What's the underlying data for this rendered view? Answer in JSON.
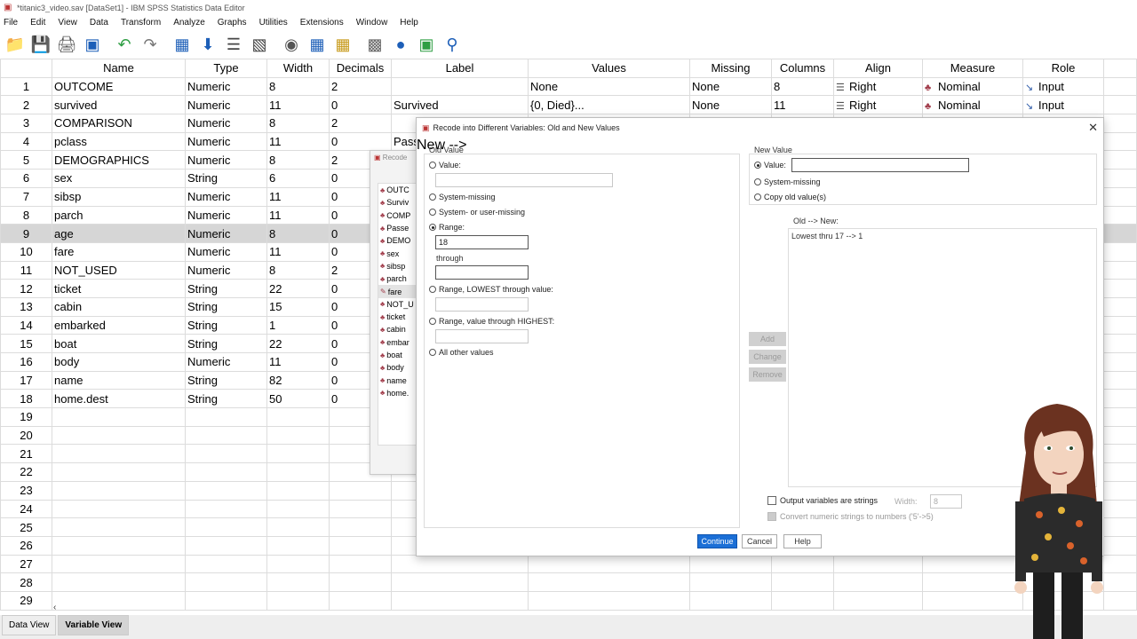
{
  "window": {
    "title": "*titanic3_video.sav [DataSet1] - IBM SPSS Statistics Data Editor"
  },
  "menu": [
    "File",
    "Edit",
    "View",
    "Data",
    "Transform",
    "Analyze",
    "Graphs",
    "Utilities",
    "Extensions",
    "Window",
    "Help"
  ],
  "grid": {
    "columns": [
      "Name",
      "Type",
      "Width",
      "Decimals",
      "Label",
      "Values",
      "Missing",
      "Columns",
      "Align",
      "Measure",
      "Role"
    ],
    "rows": [
      {
        "n": "1",
        "name": "OUTCOME",
        "type": "Numeric",
        "width": "8",
        "dec": "2",
        "label": "",
        "values": "None",
        "missing": "None",
        "cols": "8",
        "align": "Right",
        "measure": "Nominal",
        "role": "Input"
      },
      {
        "n": "2",
        "name": "survived",
        "type": "Numeric",
        "width": "11",
        "dec": "0",
        "label": "Survived",
        "values": "{0, Died}...",
        "missing": "None",
        "cols": "11",
        "align": "Right",
        "measure": "Nominal",
        "role": "Input"
      },
      {
        "n": "3",
        "name": "COMPARISON",
        "type": "Numeric",
        "width": "8",
        "dec": "2",
        "label": "",
        "values": "",
        "missing": "",
        "cols": "",
        "align": "",
        "measure": "",
        "role": ""
      },
      {
        "n": "4",
        "name": "pclass",
        "type": "Numeric",
        "width": "11",
        "dec": "0",
        "label": "Pass",
        "values": "",
        "missing": "",
        "cols": "",
        "align": "",
        "measure": "",
        "role": ""
      },
      {
        "n": "5",
        "name": "DEMOGRAPHICS",
        "type": "Numeric",
        "width": "8",
        "dec": "2",
        "label": "",
        "values": "",
        "missing": "",
        "cols": "",
        "align": "",
        "measure": "",
        "role": ""
      },
      {
        "n": "6",
        "name": "sex",
        "type": "String",
        "width": "6",
        "dec": "0",
        "label": "",
        "values": "",
        "missing": "",
        "cols": "",
        "align": "",
        "measure": "",
        "role": ""
      },
      {
        "n": "7",
        "name": "sibsp",
        "type": "Numeric",
        "width": "11",
        "dec": "0",
        "label": "",
        "values": "",
        "missing": "",
        "cols": "",
        "align": "",
        "measure": "",
        "role": ""
      },
      {
        "n": "8",
        "name": "parch",
        "type": "Numeric",
        "width": "11",
        "dec": "0",
        "label": "",
        "values": "",
        "missing": "",
        "cols": "",
        "align": "",
        "measure": "",
        "role": ""
      },
      {
        "n": "9",
        "name": "age",
        "type": "Numeric",
        "width": "8",
        "dec": "0",
        "label": "",
        "values": "",
        "missing": "",
        "cols": "",
        "align": "",
        "measure": "",
        "role": "",
        "selected": true
      },
      {
        "n": "10",
        "name": "fare",
        "type": "Numeric",
        "width": "11",
        "dec": "0",
        "label": "",
        "values": "",
        "missing": "",
        "cols": "",
        "align": "",
        "measure": "",
        "role": ""
      },
      {
        "n": "11",
        "name": "NOT_USED",
        "type": "Numeric",
        "width": "8",
        "dec": "2",
        "label": "",
        "values": "",
        "missing": "",
        "cols": "",
        "align": "",
        "measure": "",
        "role": ""
      },
      {
        "n": "12",
        "name": "ticket",
        "type": "String",
        "width": "22",
        "dec": "0",
        "label": "",
        "values": "",
        "missing": "",
        "cols": "",
        "align": "",
        "measure": "",
        "role": ""
      },
      {
        "n": "13",
        "name": "cabin",
        "type": "String",
        "width": "15",
        "dec": "0",
        "label": "",
        "values": "",
        "missing": "",
        "cols": "",
        "align": "",
        "measure": "",
        "role": ""
      },
      {
        "n": "14",
        "name": "embarked",
        "type": "String",
        "width": "1",
        "dec": "0",
        "label": "",
        "values": "",
        "missing": "",
        "cols": "",
        "align": "",
        "measure": "",
        "role": ""
      },
      {
        "n": "15",
        "name": "boat",
        "type": "String",
        "width": "22",
        "dec": "0",
        "label": "",
        "values": "",
        "missing": "",
        "cols": "",
        "align": "",
        "measure": "",
        "role": ""
      },
      {
        "n": "16",
        "name": "body",
        "type": "Numeric",
        "width": "11",
        "dec": "0",
        "label": "",
        "values": "",
        "missing": "",
        "cols": "",
        "align": "",
        "measure": "",
        "role": ""
      },
      {
        "n": "17",
        "name": "name",
        "type": "String",
        "width": "82",
        "dec": "0",
        "label": "",
        "values": "",
        "missing": "",
        "cols": "",
        "align": "",
        "measure": "",
        "role": ""
      },
      {
        "n": "18",
        "name": "home.dest",
        "type": "String",
        "width": "50",
        "dec": "0",
        "label": "",
        "values": "",
        "missing": "",
        "cols": "",
        "align": "",
        "measure": "",
        "role": ""
      },
      {
        "n": "19"
      },
      {
        "n": "20"
      },
      {
        "n": "21"
      },
      {
        "n": "22"
      },
      {
        "n": "23"
      },
      {
        "n": "24"
      },
      {
        "n": "25"
      },
      {
        "n": "26"
      },
      {
        "n": "27"
      },
      {
        "n": "28"
      },
      {
        "n": "29"
      }
    ]
  },
  "bottom_tabs": {
    "data_view": "Data View",
    "variable_view": "Variable View"
  },
  "bg_dialog": {
    "title": "Recode",
    "vars": [
      "OUTC",
      "Surviv",
      "COMP",
      "Passe",
      "DEMO",
      "sex",
      "sibsp",
      "parch",
      "fare",
      "NOT_U",
      "ticket",
      "cabin",
      "embar",
      "boat",
      "body",
      "name",
      "home."
    ]
  },
  "dialog": {
    "title": "Recode into Different Variables: Old and New Values",
    "old_value": {
      "legend": "Old Value",
      "value_label": "Value:",
      "system_missing": "System-missing",
      "sys_or_user_missing": "System- or user-missing",
      "range_label": "Range:",
      "range_from": "18",
      "through": "through",
      "range_to": "",
      "lowest_through": "Range, LOWEST through value:",
      "value_through_highest": "Range, value through HIGHEST:",
      "all_other": "All other values"
    },
    "new_value": {
      "legend": "New Value",
      "value_label": "Value:",
      "value": "",
      "system_missing": "System-missing",
      "copy_old": "Copy old value(s)"
    },
    "old_new": {
      "label": "Old --> New:",
      "items": [
        "Lowest thru 17 --> 1"
      ]
    },
    "buttons": {
      "add": "Add",
      "change": "Change",
      "remove": "Remove",
      "continue": "Continue",
      "cancel": "Cancel",
      "help": "Help"
    },
    "options": {
      "output_strings": "Output variables are strings",
      "width_label": "Width:",
      "width_value": "8",
      "convert_numeric": "Convert numeric strings to numbers ('5'->5)"
    }
  }
}
